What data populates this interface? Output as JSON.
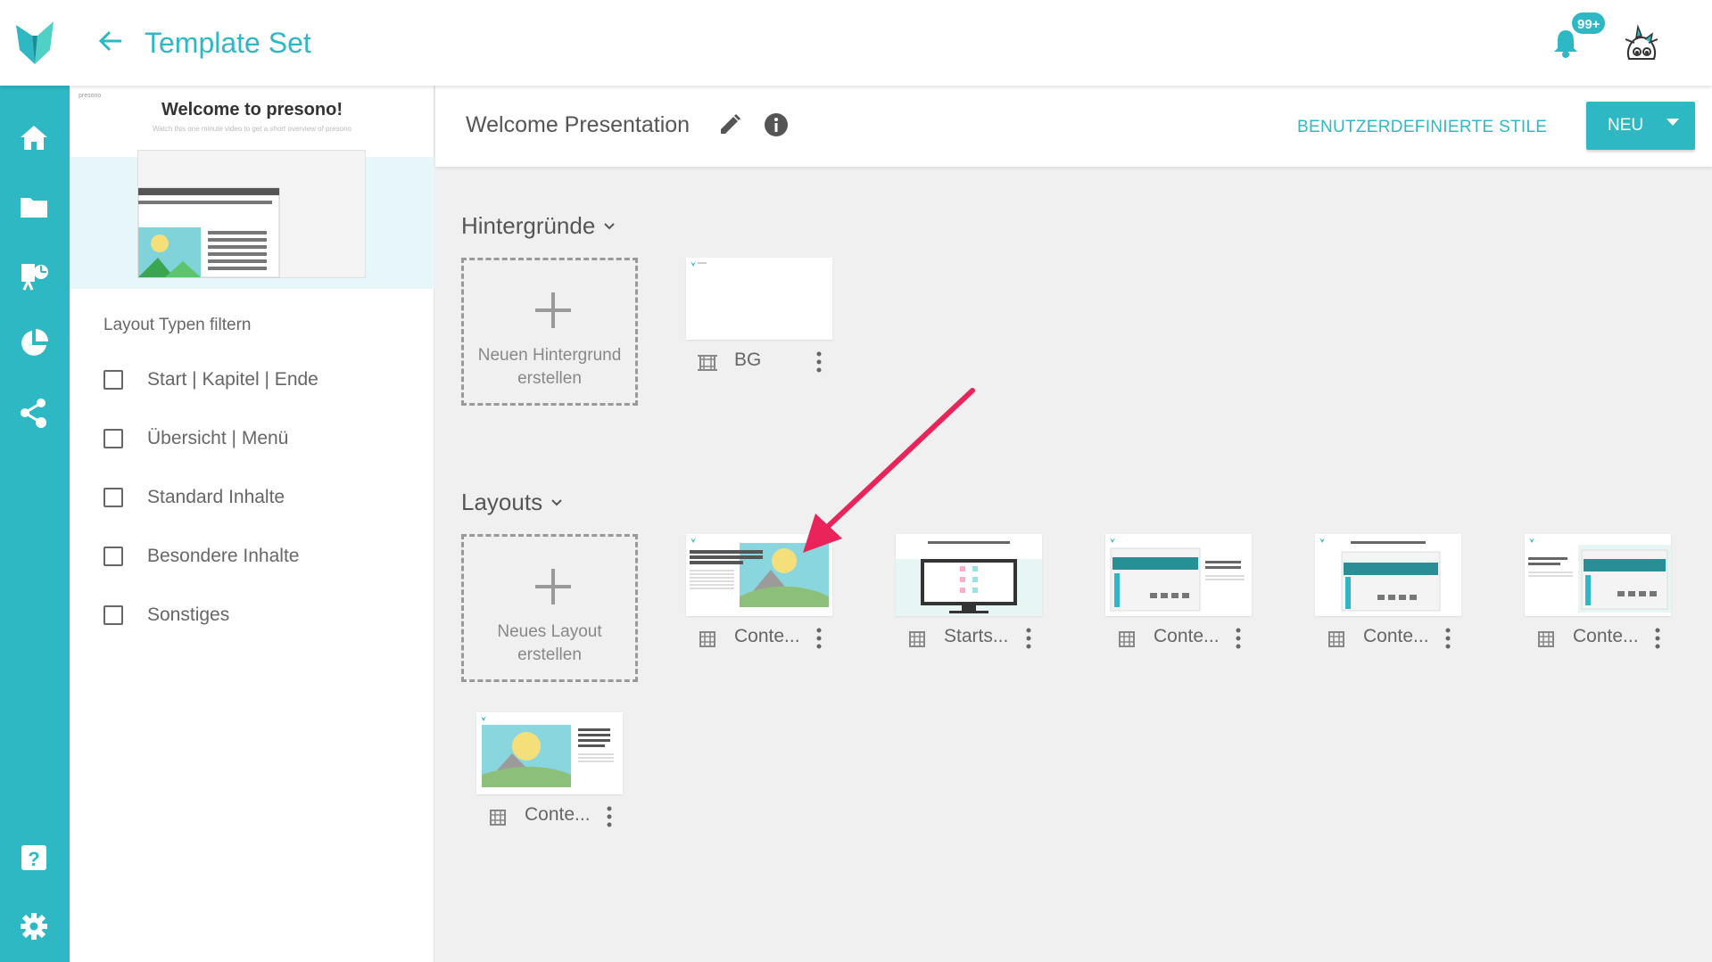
{
  "header": {
    "title": "Template Set",
    "notification_count": "99+"
  },
  "colors": {
    "accent": "#2eb8c4",
    "arrow": "#e8245a"
  },
  "rail": {
    "icons": [
      "home-icon",
      "folder-icon",
      "presentation-icon",
      "pie-chart-icon",
      "share-icon",
      "help-icon",
      "settings-icon"
    ]
  },
  "sidebar": {
    "video": {
      "brand": "presono",
      "title": "Welcome to presono!",
      "subtitle": "Watch this one minute video to get a short overview of presono"
    },
    "filter_title": "Layout Typen filtern",
    "filters": [
      {
        "label": "Start | Kapitel | Ende",
        "checked": false
      },
      {
        "label": "Übersicht | Menü",
        "checked": false
      },
      {
        "label": "Standard Inhalte",
        "checked": false
      },
      {
        "label": "Besondere Inhalte",
        "checked": false
      },
      {
        "label": "Sonstiges",
        "checked": false
      }
    ]
  },
  "main": {
    "presentation_title": "Welcome Presentation",
    "custom_styles_label": "BENUTZERDEFINIERTE STILE",
    "new_button_label": "NEU",
    "backgrounds": {
      "title": "Hintergründe",
      "add_label_1": "Neuen Hintergrund",
      "add_label_2": "erstellen",
      "items": [
        {
          "name": "BG"
        }
      ]
    },
    "layouts": {
      "title": "Layouts",
      "add_label_1": "Neues Layout",
      "add_label_2": "erstellen",
      "items": [
        {
          "name": "Conte...",
          "thumb_text": "Ut enim ad minim veniam, quis nostrud exercitation ullamco laboris nisi ut aliquip ex ea commodi consequat."
        },
        {
          "name": "Starts...",
          "thumb_text": "Überschrift hier einfügen"
        },
        {
          "name": "Conte...",
          "thumb_text": "Überschrift hier einfügen"
        },
        {
          "name": "Conte...",
          "thumb_text": "Überschrift hier einfügen"
        },
        {
          "name": "Conte...",
          "thumb_text": "Überschrift hier einfügen"
        },
        {
          "name": "Conte...",
          "thumb_text": "officia deserunt mollit anim id est laborum."
        }
      ]
    }
  }
}
